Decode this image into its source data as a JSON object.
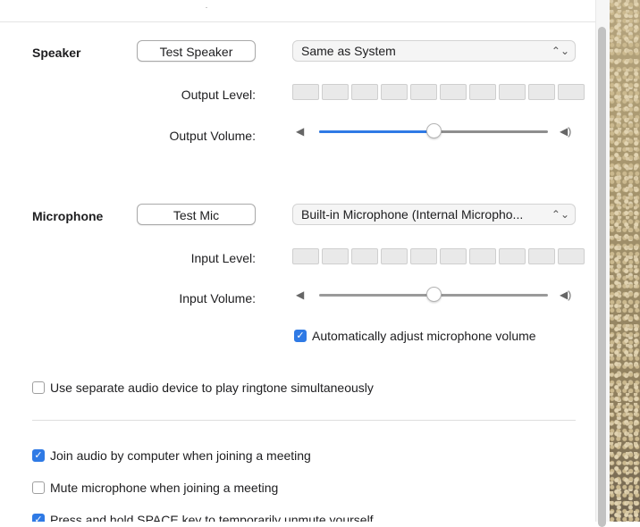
{
  "speaker": {
    "title": "Speaker",
    "test_button": "Test Speaker",
    "device": "Same as System",
    "output_level_label": "Output Level:",
    "output_volume_label": "Output Volume:",
    "output_volume_value": 0.5
  },
  "microphone": {
    "title": "Microphone",
    "test_button": "Test Mic",
    "device": "Built-in Microphone (Internal Micropho...",
    "input_level_label": "Input Level:",
    "input_volume_label": "Input Volume:",
    "input_volume_value": 0.5,
    "auto_adjust": {
      "label": "Automatically adjust microphone volume",
      "checked": true
    }
  },
  "icons": {
    "dropdown": "chevron-up-down-icon",
    "volume_low": "speaker-low-icon",
    "volume_high": "speaker-high-icon",
    "check": "checkmark-icon"
  },
  "options": {
    "separate_ringtone": {
      "label": "Use separate audio device to play ringtone simultaneously",
      "checked": false
    },
    "join_by_computer": {
      "label": "Join audio by computer when joining a meeting",
      "checked": true
    },
    "mute_on_join": {
      "label": "Mute microphone when joining a meeting",
      "checked": false
    },
    "press_space_unmute": {
      "label": "Press and hold SPACE key to temporarily unmute yourself",
      "checked": true
    }
  },
  "colors": {
    "accent": "#2f7ae5",
    "track": "#8e8e8e"
  }
}
